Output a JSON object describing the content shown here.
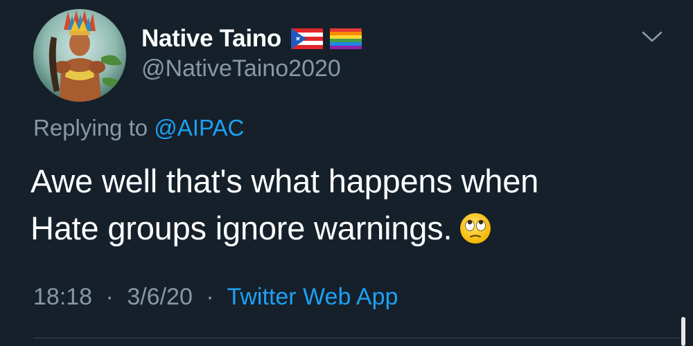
{
  "user": {
    "display_name": "Native Taino",
    "handle": "@NativeTaino2020",
    "badges": [
      "puerto-rico-flag-icon",
      "rainbow-flag-icon"
    ]
  },
  "reply": {
    "prefix": "Replying to",
    "mention": "@AIPAC"
  },
  "tweet": {
    "line1": "Awe well that's what happens when",
    "line2": "Hate groups ignore warnings.",
    "emoji": "face-with-rolling-eyes-icon"
  },
  "meta": {
    "time": "18:18",
    "date": "3/6/20",
    "separator": "·",
    "source": "Twitter Web App"
  },
  "colors": {
    "background": "#15202b",
    "text_primary": "#ffffff",
    "text_secondary": "#8899a6",
    "accent": "#1da1f2",
    "divider": "#38444d"
  }
}
